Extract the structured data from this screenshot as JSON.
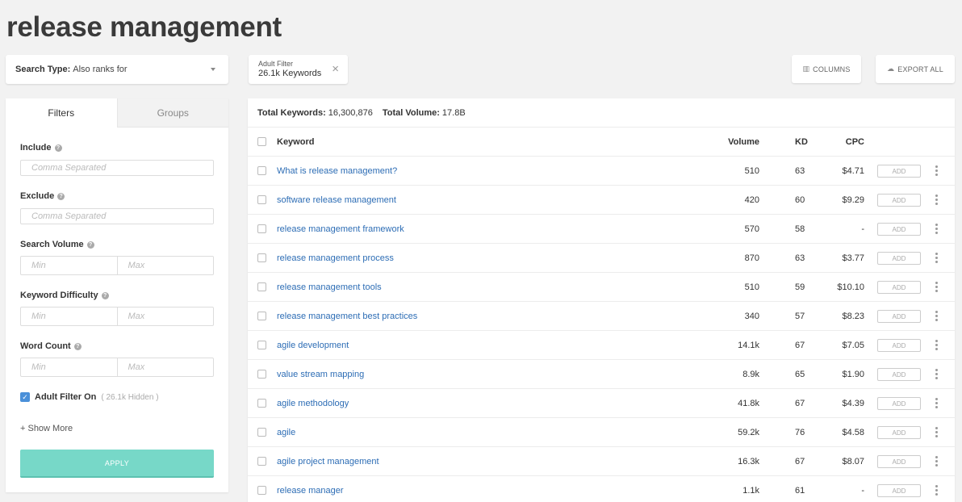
{
  "page": {
    "title": "release management"
  },
  "search_type": {
    "label": "Search Type:",
    "value": "Also ranks for"
  },
  "filter_chip": {
    "label": "Adult Filter",
    "count": "26.1k Keywords",
    "close": "×"
  },
  "toolbar": {
    "columns_label": "COLUMNS",
    "export_label": "EXPORT ALL"
  },
  "sidebar": {
    "tabs": [
      {
        "label": "Filters"
      },
      {
        "label": "Groups"
      }
    ],
    "include": {
      "label": "Include",
      "placeholder": "Comma Separated"
    },
    "exclude": {
      "label": "Exclude",
      "placeholder": "Comma Separated"
    },
    "search_volume": {
      "label": "Search Volume",
      "min": "Min",
      "max": "Max"
    },
    "keyword_difficulty": {
      "label": "Keyword Difficulty",
      "min": "Min",
      "max": "Max"
    },
    "word_count": {
      "label": "Word Count",
      "min": "Min",
      "max": "Max"
    },
    "adult_filter": {
      "label": "Adult Filter On",
      "hidden": "( 26.1k Hidden )"
    },
    "show_more": "+ Show More",
    "apply": "APPLY"
  },
  "totals": {
    "keywords_label": "Total Keywords:",
    "keywords_value": "16,300,876",
    "volume_label": "Total Volume:",
    "volume_value": "17.8B"
  },
  "table": {
    "headers": {
      "keyword": "Keyword",
      "volume": "Volume",
      "kd": "KD",
      "cpc": "CPC"
    },
    "add_label": "ADD",
    "rows": [
      {
        "keyword": "What is release management?",
        "volume": "510",
        "kd": "63",
        "cpc": "$4.71"
      },
      {
        "keyword": "software release management",
        "volume": "420",
        "kd": "60",
        "cpc": "$9.29"
      },
      {
        "keyword": "release management framework",
        "volume": "570",
        "kd": "58",
        "cpc": "-"
      },
      {
        "keyword": "release management process",
        "volume": "870",
        "kd": "63",
        "cpc": "$3.77"
      },
      {
        "keyword": "release management tools",
        "volume": "510",
        "kd": "59",
        "cpc": "$10.10"
      },
      {
        "keyword": "release management best practices",
        "volume": "340",
        "kd": "57",
        "cpc": "$8.23"
      },
      {
        "keyword": "agile development",
        "volume": "14.1k",
        "kd": "67",
        "cpc": "$7.05"
      },
      {
        "keyword": "value stream mapping",
        "volume": "8.9k",
        "kd": "65",
        "cpc": "$1.90"
      },
      {
        "keyword": "agile methodology",
        "volume": "41.8k",
        "kd": "67",
        "cpc": "$4.39"
      },
      {
        "keyword": "agile",
        "volume": "59.2k",
        "kd": "76",
        "cpc": "$4.58"
      },
      {
        "keyword": "agile project management",
        "volume": "16.3k",
        "kd": "67",
        "cpc": "$8.07"
      },
      {
        "keyword": "release manager",
        "volume": "1.1k",
        "kd": "61",
        "cpc": "-"
      }
    ]
  }
}
